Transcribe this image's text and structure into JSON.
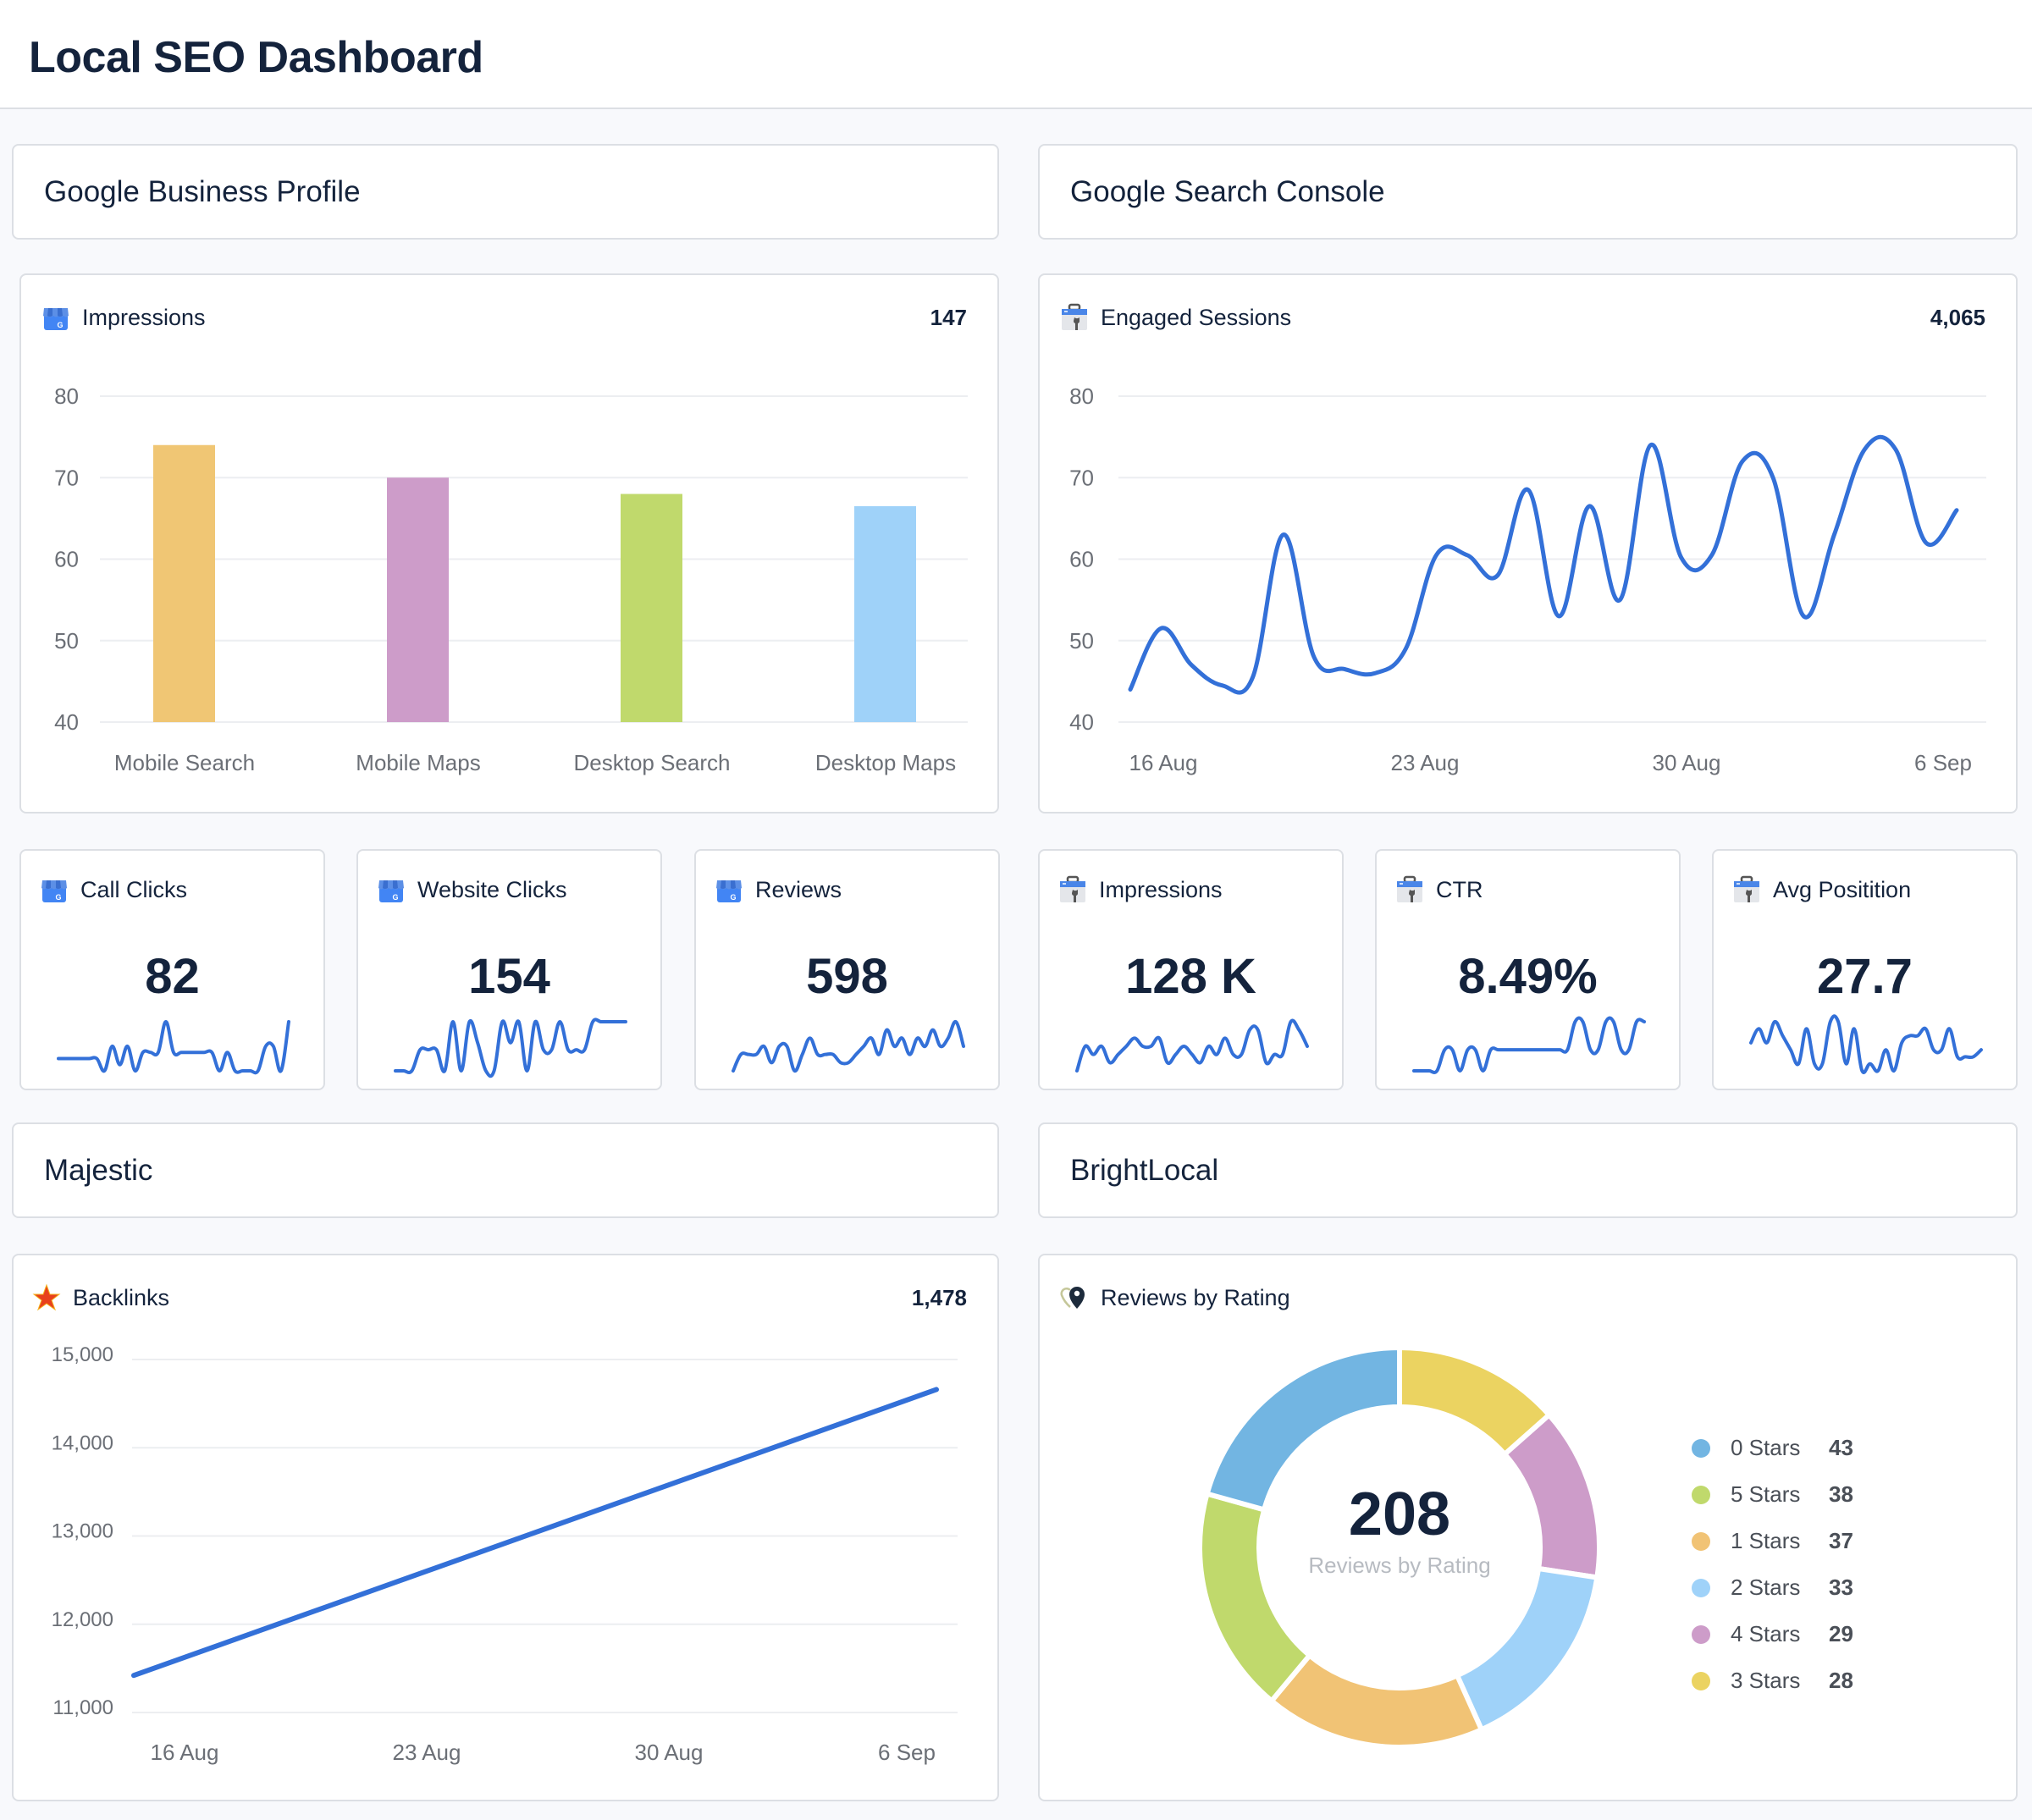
{
  "page": {
    "title": "Local SEO Dashboard"
  },
  "sections": {
    "gbp": {
      "title": "Google Business Profile"
    },
    "gsc": {
      "title": "Google Search Console"
    },
    "majestic": {
      "title": "Majestic"
    },
    "brightlocal": {
      "title": "BrightLocal"
    }
  },
  "icons": {
    "gbp": "google-business-profile-icon",
    "gsc": "google-search-console-icon",
    "majestic": "star-icon",
    "brightlocal": "map-pin-heart-icon"
  },
  "colors": {
    "line": "#3370d8",
    "grid": "#eceef1",
    "axis_text": "#6b6f76",
    "bar_mobile_search": "#f0c674",
    "bar_mobile_maps": "#cd9cc9",
    "bar_desktop_search": "#c0d96c",
    "bar_desktop_maps": "#9fd2f9"
  },
  "kpis": [
    {
      "label": "Call Clicks",
      "value": "82",
      "source": "gbp",
      "trend": [
        3,
        3,
        3,
        3,
        3,
        3,
        1,
        5,
        2,
        5,
        1,
        4,
        4,
        4,
        9,
        4,
        4,
        4,
        4,
        4,
        4,
        1,
        4,
        1,
        1,
        1,
        1,
        5,
        5,
        1,
        9
      ]
    },
    {
      "label": "Website Clicks",
      "value": "154",
      "source": "gbp",
      "trend": [
        1,
        1,
        1,
        4,
        4,
        4,
        1,
        8,
        1,
        8,
        5,
        1,
        1,
        8,
        5,
        8,
        1,
        8,
        4,
        4,
        8,
        4,
        4,
        4,
        8,
        8,
        8,
        8,
        8
      ]
    },
    {
      "label": "Reviews",
      "value": "598",
      "source": "gbp",
      "trend": [
        1,
        3,
        3,
        3,
        4,
        2,
        4,
        4,
        1,
        3,
        5,
        3,
        3,
        3,
        2,
        2,
        3,
        4,
        5,
        3,
        6,
        4,
        5,
        3,
        5,
        4,
        6,
        4,
        5,
        7,
        4
      ]
    },
    {
      "label": "Impressions",
      "value": "128 K",
      "source": "gsc",
      "trend": [
        1,
        4,
        3,
        4,
        2,
        3,
        4,
        5,
        4,
        4,
        5,
        2,
        3,
        4,
        3,
        2,
        4,
        3,
        5,
        3,
        3,
        6,
        6,
        2,
        3,
        3,
        7,
        6,
        4
      ]
    },
    {
      "label": "CTR",
      "value": "8.49%",
      "source": "gsc",
      "trend": [
        1,
        1,
        1,
        1,
        4,
        4,
        1,
        4,
        4,
        1,
        4,
        4,
        4,
        4,
        4,
        4,
        4,
        4,
        4,
        4,
        4,
        8,
        8,
        4,
        4,
        8,
        8,
        4,
        4,
        8,
        8
      ]
    },
    {
      "label": "Avg Positition",
      "value": "27.7",
      "source": "gsc",
      "trend": [
        5,
        7,
        5,
        8,
        6,
        4,
        2,
        7,
        2,
        2,
        8,
        8,
        2,
        7,
        1,
        2,
        1,
        4,
        1,
        5,
        6,
        6,
        7,
        4,
        4,
        7,
        3,
        3,
        3,
        4
      ]
    }
  ],
  "chart_data": [
    {
      "id": "gbp-impressions",
      "type": "bar",
      "title": "Impressions",
      "total": "147",
      "categories": [
        "Mobile Search",
        "Mobile Maps",
        "Desktop Search",
        "Desktop Maps"
      ],
      "values": [
        74,
        70,
        68,
        66.5
      ],
      "ylim": [
        40,
        80
      ],
      "yticks": [
        80,
        70,
        60,
        50,
        40
      ],
      "grid": true
    },
    {
      "id": "gsc-engaged-sessions",
      "type": "line",
      "title": "Engaged Sessions",
      "total": "4,065",
      "xticks": [
        "16 Aug",
        "23 Aug",
        "30 Aug",
        "6 Sep"
      ],
      "values": [
        44,
        51.5,
        47,
        44.5,
        45.5,
        63,
        48,
        46.5,
        46,
        49,
        60.5,
        60.5,
        58,
        68.5,
        53,
        66.5,
        55,
        74,
        60.2,
        60.5,
        72,
        70,
        53,
        63,
        73.5,
        73.5,
        62,
        66
      ],
      "ylim": [
        40,
        80
      ],
      "yticks": [
        80,
        70,
        60,
        50,
        40
      ],
      "grid": true
    },
    {
      "id": "majestic-backlinks",
      "type": "line",
      "title": "Backlinks",
      "total": "1,478",
      "xticks": [
        "16 Aug",
        "23 Aug",
        "30 Aug",
        "6 Sep"
      ],
      "x_range_days": [
        0,
        22
      ],
      "values": [
        11420,
        14660
      ],
      "ylim": [
        11000,
        15000
      ],
      "yticks": [
        "15,000",
        "14,000",
        "13,000",
        "12,000",
        "11,000"
      ],
      "grid": true
    },
    {
      "id": "brightlocal-reviews-by-rating",
      "type": "pie",
      "title": "Reviews by Rating",
      "center_value": "208",
      "center_label": "Reviews by Rating",
      "legend_position": "right",
      "legend": [
        {
          "label": "0 Stars",
          "value": 43,
          "color": "#72b5e2"
        },
        {
          "label": "5 Stars",
          "value": 38,
          "color": "#c0d96c"
        },
        {
          "label": "1 Stars",
          "value": 37,
          "color": "#f1c375"
        },
        {
          "label": "2 Stars",
          "value": 33,
          "color": "#9fd2f9"
        },
        {
          "label": "4 Stars",
          "value": 29,
          "color": "#cd9cc9"
        },
        {
          "label": "3 Stars",
          "value": 28,
          "color": "#ebd361"
        }
      ],
      "slices_clockwise_from_top": [
        "3 Stars",
        "4 Stars",
        "2 Stars",
        "1 Stars",
        "5 Stars",
        "0 Stars"
      ]
    }
  ]
}
